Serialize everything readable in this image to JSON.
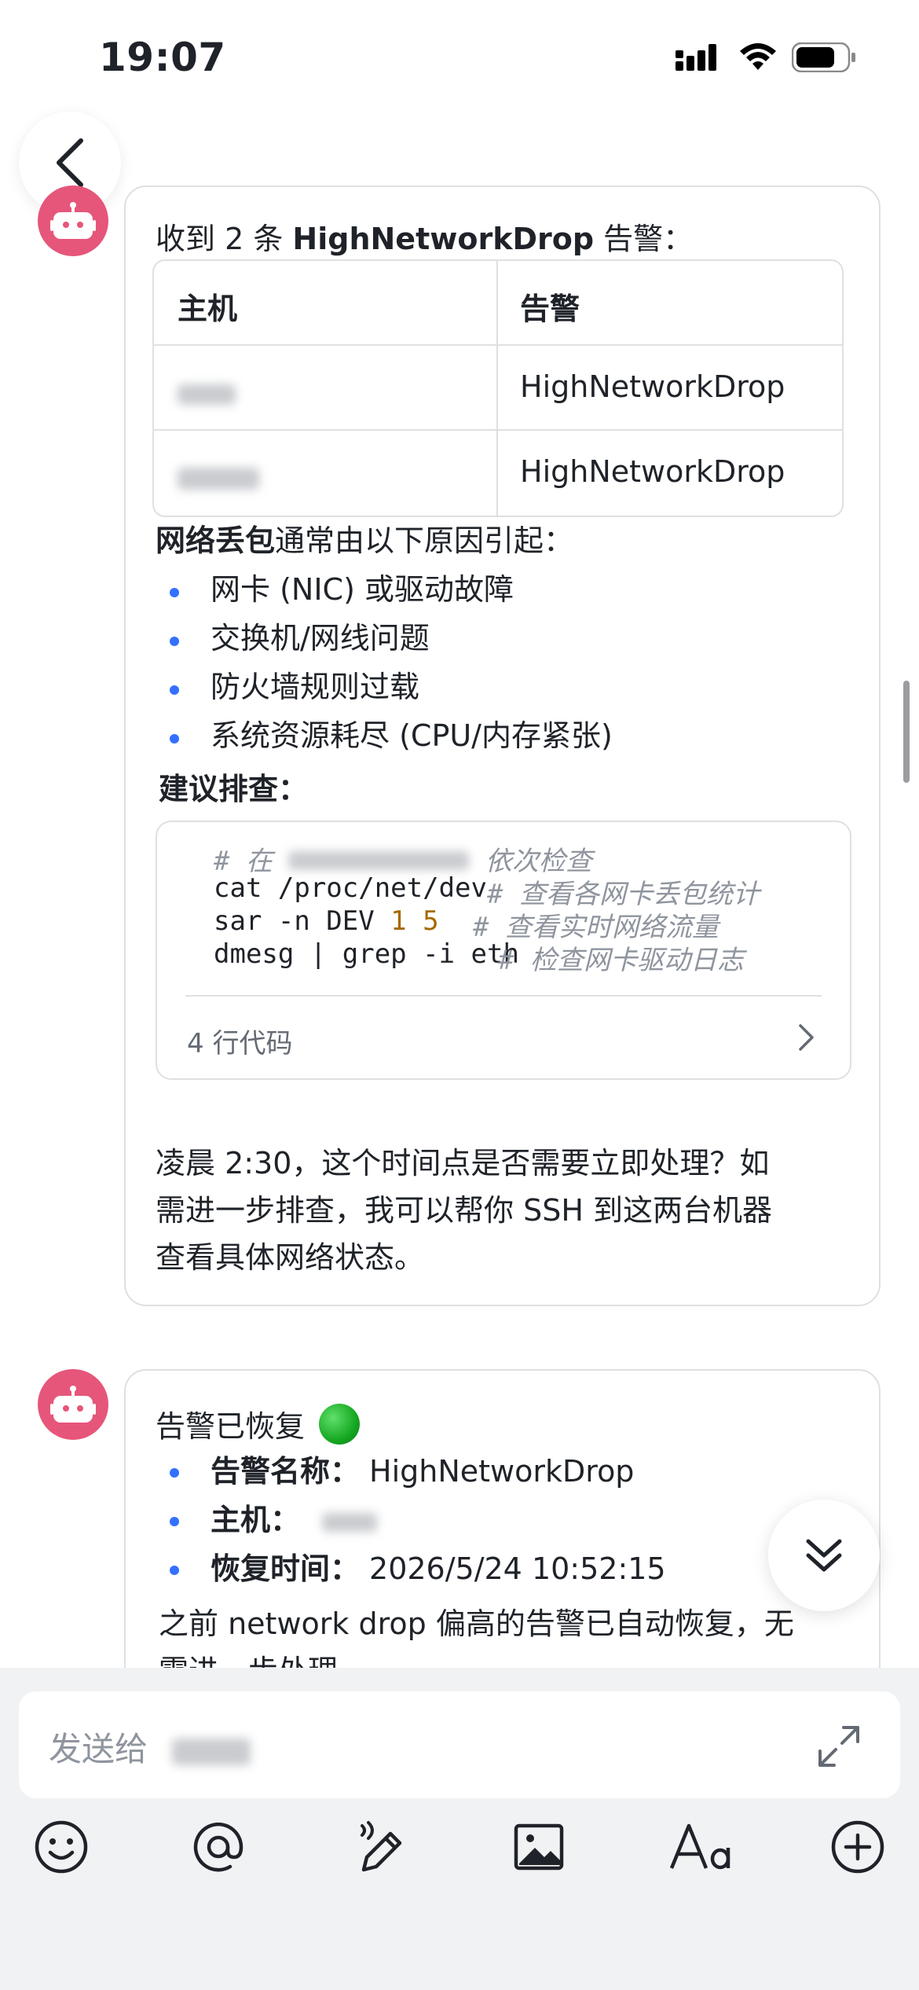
{
  "status_bar": {
    "time": "19:07"
  },
  "message1": {
    "intro_prefix": "收到 2 条 ",
    "intro_bold": "HighNetworkDrop",
    "intro_suffix": " 告警：",
    "table": {
      "headers": [
        "主机",
        "告警"
      ],
      "rows": [
        {
          "host": "",
          "alert": "HighNetworkDrop"
        },
        {
          "host": "",
          "alert": "HighNetworkDrop"
        }
      ]
    },
    "cause_bold": "网络丢包",
    "cause_rest": "通常由以下原因引起：",
    "causes": [
      "网卡 (NIC) 或驱动故障",
      "交换机/网线问题",
      "防火墙规则过载",
      "系统资源耗尽 (CPU/内存紧张)"
    ],
    "suggest_title": "建议排查：",
    "code": {
      "comment_prefix": "# 在 ",
      "comment_suffix": " 依次检查",
      "lines": [
        {
          "cmd": "cat /proc/net/dev",
          "comment": "# 查看各网卡丢包统计"
        },
        {
          "cmd_prefix": "sar -n DEV ",
          "cmd_nums": "1 5",
          "comment": "# 查看实时网络流量"
        },
        {
          "cmd": "dmesg | grep -i eth",
          "comment": "# 检查网卡驱动日志"
        }
      ],
      "footer": "4 行代码"
    },
    "closing": [
      "凌晨 2:30，这个时间点是否需要立即处理？如",
      "需进一步排查，我可以帮你 SSH 到这两台机器",
      "查看具体网络状态。"
    ]
  },
  "message2": {
    "title": "告警已恢复",
    "status_emoji": "🟢",
    "fields": [
      {
        "label": "告警名称：",
        "value": "HighNetworkDrop"
      },
      {
        "label": "主机：",
        "value": ""
      },
      {
        "label": "恢复时间：",
        "value": "2026/5/24 10:52:15"
      }
    ],
    "note_line1": "之前 network drop 偏高的告警已自动恢复，无",
    "note_line2": "需进一步处理"
  },
  "composer": {
    "placeholder": "发送给"
  },
  "icons": [
    "back-chevron-icon",
    "bot-avatar-icon",
    "signal-icon",
    "wifi-icon",
    "battery-icon",
    "chevron-right-icon",
    "double-chevron-down-icon",
    "expand-icon",
    "emoji-icon",
    "mention-icon",
    "handwriting-icon",
    "image-icon",
    "text-format-icon",
    "add-circle-icon"
  ],
  "colors": {
    "accent": "#3370ff",
    "avatar": "#e6567a",
    "border": "#dee0e3",
    "composer_bg": "#f1f2f4"
  }
}
